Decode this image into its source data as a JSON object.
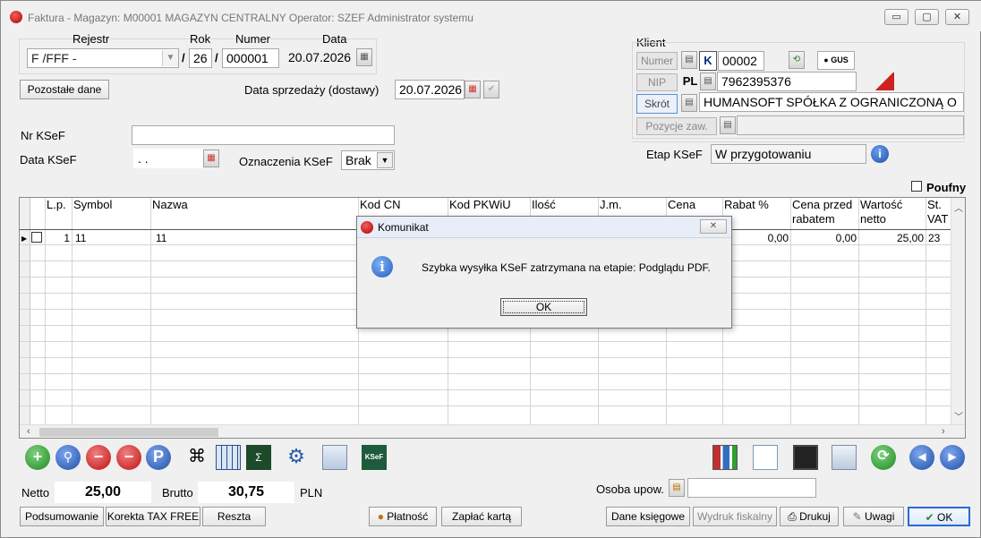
{
  "window": {
    "title": "Faktura - Magazyn: M00001 MAGAZYN CENTRALNY  Operator: SZEF Administrator systemu",
    "min": "▭",
    "max": "▢",
    "close": "✕"
  },
  "header": {
    "rejestr_label": "Rejestr",
    "rok_label": "Rok",
    "numer_label": "Numer",
    "data_label": "Data",
    "rejestr_value": "F /FFF -",
    "sep1": "/",
    "rok_value": "26",
    "sep2": "/",
    "numer_value": "000001",
    "data_value": "20.07.2026",
    "pozostale_btn": "Pozostałe dane",
    "data_sprzedazy_label": "Data sprzedaży (dostawy)",
    "data_sprzedazy_value": "20.07.2026",
    "nr_ksef_label": "Nr KSeF",
    "nr_ksef_value": "",
    "data_ksef_label": "Data KSeF",
    "data_ksef_value": " .  .",
    "oznaczenia_label": "Oznaczenia KSeF",
    "oznaczenia_value": "Brak"
  },
  "client": {
    "section_label": "Klient",
    "numer_btn": "Numer",
    "k_label": "K",
    "numer_value": "00002",
    "nip_btn": "NIP",
    "pl_label": "PL",
    "nip_value": "7962395376",
    "skrot_btn": "Skrót",
    "skrot_value": "HUMANSOFT SPÓŁKA Z OGRANICZONĄ O",
    "pozycje_btn": "Pozycje zaw.",
    "pozycje_value": "",
    "gus_label": "GUS",
    "etap_label": "Etap KSeF",
    "etap_value": "W przygotowaniu",
    "poufny_label": "Poufny"
  },
  "grid": {
    "headers": [
      "L.p.",
      "Symbol",
      "Nazwa",
      "Kod  CN",
      "Kod  PKWiU",
      "Ilość",
      "J.m.",
      "Cena",
      "Rabat %",
      "Cena przed rabatem",
      "Wartość netto",
      "St. VAT"
    ],
    "row": {
      "lp": "1",
      "symbol": "11",
      "nazwa": "11",
      "rabat": "0,00",
      "cena_przed": "0,00",
      "wartosc": "25,00",
      "vat": "23"
    }
  },
  "dialog": {
    "title": "Komunikat",
    "message": "Szybka wysyłka KSeF zatrzymana na etapie: Podglądu PDF.",
    "ok": "OK",
    "close": "✕"
  },
  "totals": {
    "netto_label": "Netto",
    "netto_value": "25,00",
    "brutto_label": "Brutto",
    "brutto_value": "30,75",
    "currency": "PLN",
    "osoba_label": "Osoba upow.",
    "osoba_value": ""
  },
  "buttons": {
    "podsumowanie": "Podsumowanie",
    "korekta": "Korekta TAX FREE",
    "reszta": "Reszta",
    "platnosc": "Płatność",
    "zaplac": "Zapłać kartą",
    "dane_ksiegowe": "Dane księgowe",
    "wydruk": "Wydruk fiskalny",
    "drukuj": "Drukuj",
    "uwagi": "Uwagi",
    "ok": "OK"
  },
  "colors": {
    "accent": "#1f5fb5",
    "dialog_icon": "#2f6fd0",
    "add": "#2ea043",
    "delete": "#d62020"
  }
}
